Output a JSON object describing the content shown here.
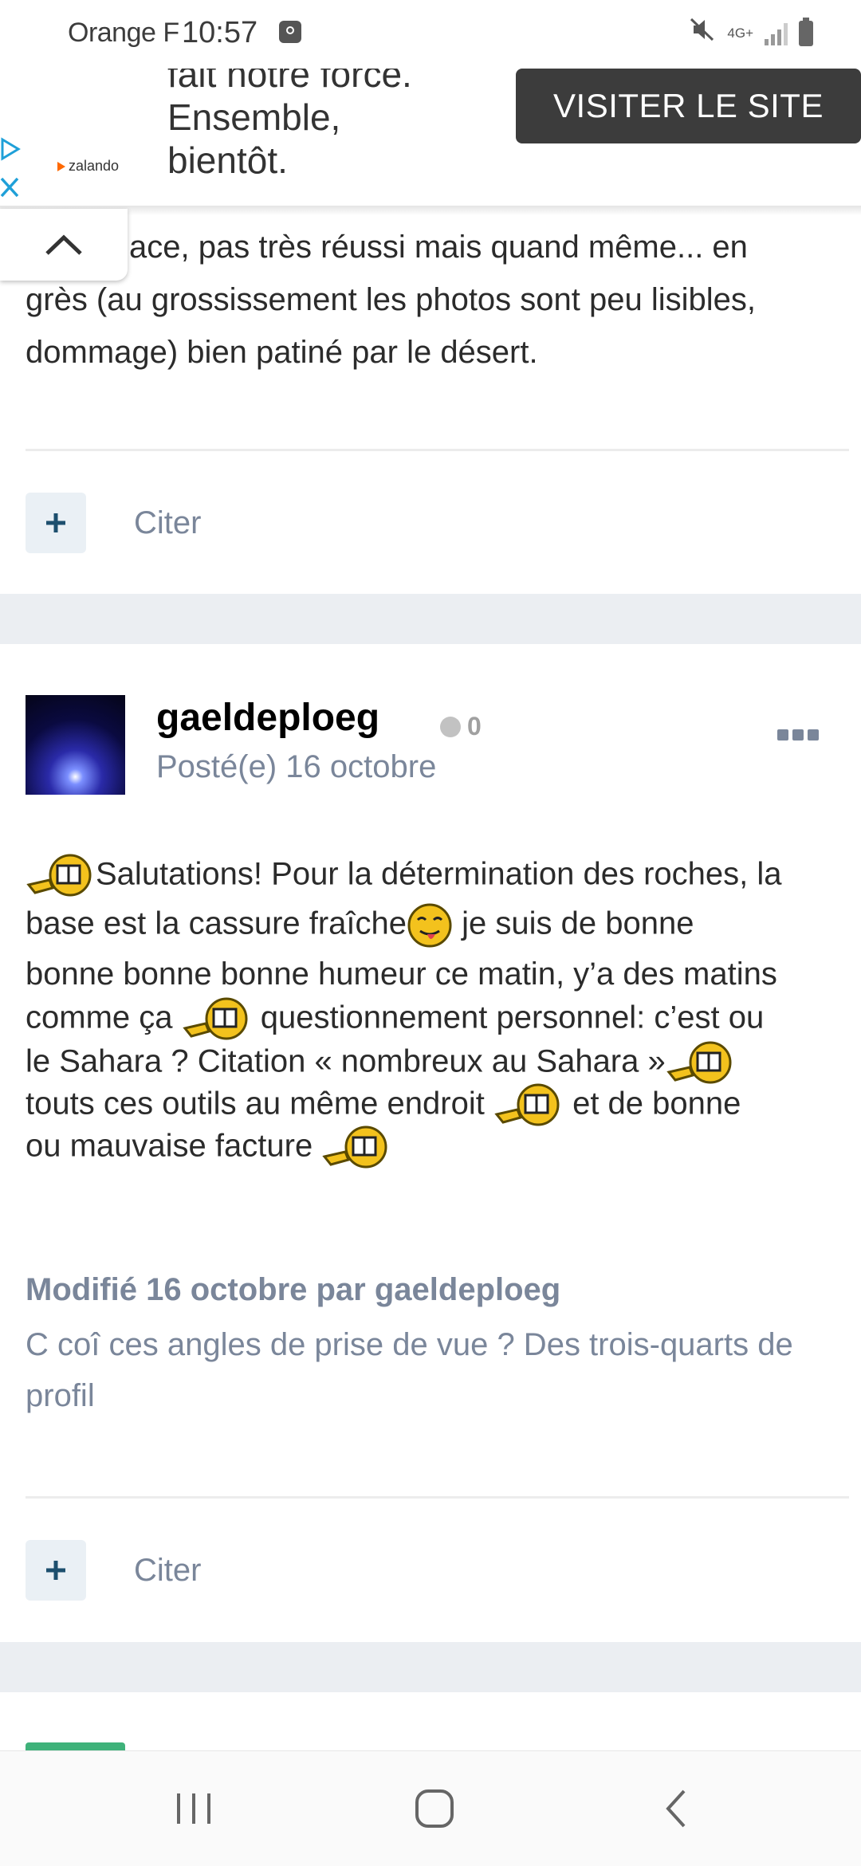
{
  "status_bar": {
    "carrier": "Orange F",
    "time": "10:57",
    "network": "4G+",
    "icons": [
      "alarm-icon",
      "mute-icon",
      "signal-icon",
      "battery-icon"
    ]
  },
  "ad": {
    "brand": "zalando",
    "text_lines": [
      "fait notre force.",
      "Ensemble,",
      "bientôt."
    ],
    "button_label": "VISITER LE SITE"
  },
  "previous_post": {
    "text_line1": "ace, pas très réussi mais quand même... en",
    "text_line2": "grès (au grossissement les photos sont peu lisibles,",
    "text_line3": "dommage) bien patiné par le désert.",
    "quote_label": "Citer"
  },
  "post": {
    "author": "gaeldeploeg",
    "reputation": "0",
    "date": "Posté(e) 16 octobre",
    "body_lines": [
      [
        "emoji",
        "Salutations! Pour la détermination des roches, la"
      ],
      [
        "base est la cassure fraîche",
        "emoji-tongue",
        " je suis de bonne"
      ],
      [
        "bonne bonne bonne humeur ce matin, y’a des matins"
      ],
      [
        "comme ça ",
        "emoji",
        " questionnement personnel: c’est ou"
      ],
      [
        "le Sahara ? Citation « nombreux au Sahara »",
        "emoji"
      ],
      [
        " touts ces outils au même endroit ",
        "emoji",
        " et de bonne"
      ],
      [
        "ou mauvaise facture ",
        "emoji"
      ]
    ],
    "l1": "Salutations! Pour la détermination des roches, la",
    "l2a": "base est la cassure fraîche",
    "l2b": " je suis de bonne",
    "l3": "bonne bonne bonne humeur ce matin, y’a des matins",
    "l4a": "comme ça ",
    "l4b": " questionnement personnel: c’est ou",
    "l5": "le Sahara ? Citation « nombreux au Sahara »",
    "l6a": " touts ces outils au même endroit ",
    "l6b": " et de bonne",
    "l7": "ou mauvaise facture ",
    "edit_label": "Modifié 16 octobre par gaeldeploeg",
    "edit_reason": "C coî ces angles de prise de vue ? Des trois-quarts de profil",
    "quote_label": "Citer"
  },
  "colors": {
    "accent": "#1d4f6e",
    "muted": "#7a869a",
    "band": "#ebeef2",
    "ad_button": "#3c3c3c"
  }
}
